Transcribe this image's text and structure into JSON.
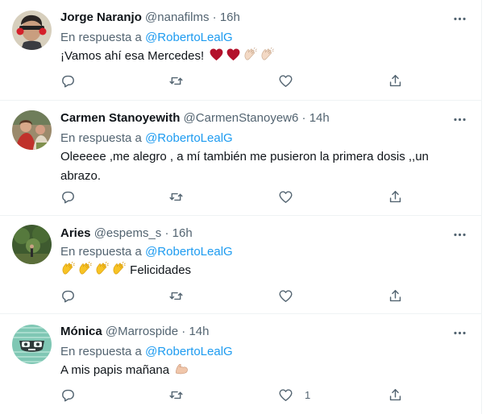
{
  "colors": {
    "name": "#0f1419",
    "secondary": "#536471",
    "link": "#1d9bf0",
    "border": "#eff3f4"
  },
  "replies": [
    {
      "name": "Jorge Naranjo",
      "handle": "@nanafilms",
      "separator": "·",
      "time": "16h",
      "reply_prefix": "En respuesta a",
      "reply_to": "@RobertoLealG",
      "text": "¡Vamos ahí esa Mercedes!",
      "emojis": [
        "heart-emoji",
        "heart-emoji",
        "clapping-hands-emoji",
        "clapping-hands-emoji"
      ],
      "like_count": ""
    },
    {
      "name": "Carmen Stanoyewith",
      "handle": "@CarmenStanoyew6",
      "separator": "·",
      "time": "14h",
      "reply_prefix": "En respuesta a",
      "reply_to": "@RobertoLealG",
      "text": "Oleeeee ,me alegro , a mí también me pusieron la primera dosis ,,un abrazo.",
      "like_count": ""
    },
    {
      "name": "Aries",
      "handle": "@espems_s",
      "separator": "·",
      "time": "16h",
      "reply_prefix": "En respuesta a",
      "reply_to": "@RobertoLealG",
      "text": "Felicidades",
      "emojis": [
        "clapping-hands-emoji",
        "clapping-hands-emoji",
        "clapping-hands-emoji",
        "clapping-hands-emoji"
      ],
      "like_count": ""
    },
    {
      "name": "Mónica",
      "handle": "@Marrospide",
      "separator": "·",
      "time": "14h",
      "reply_prefix": "En respuesta a",
      "reply_to": "@RobertoLealG",
      "text": "A mis papis mañana",
      "emojis": [
        "flexed-biceps-emoji"
      ],
      "like_count": "1"
    }
  ]
}
